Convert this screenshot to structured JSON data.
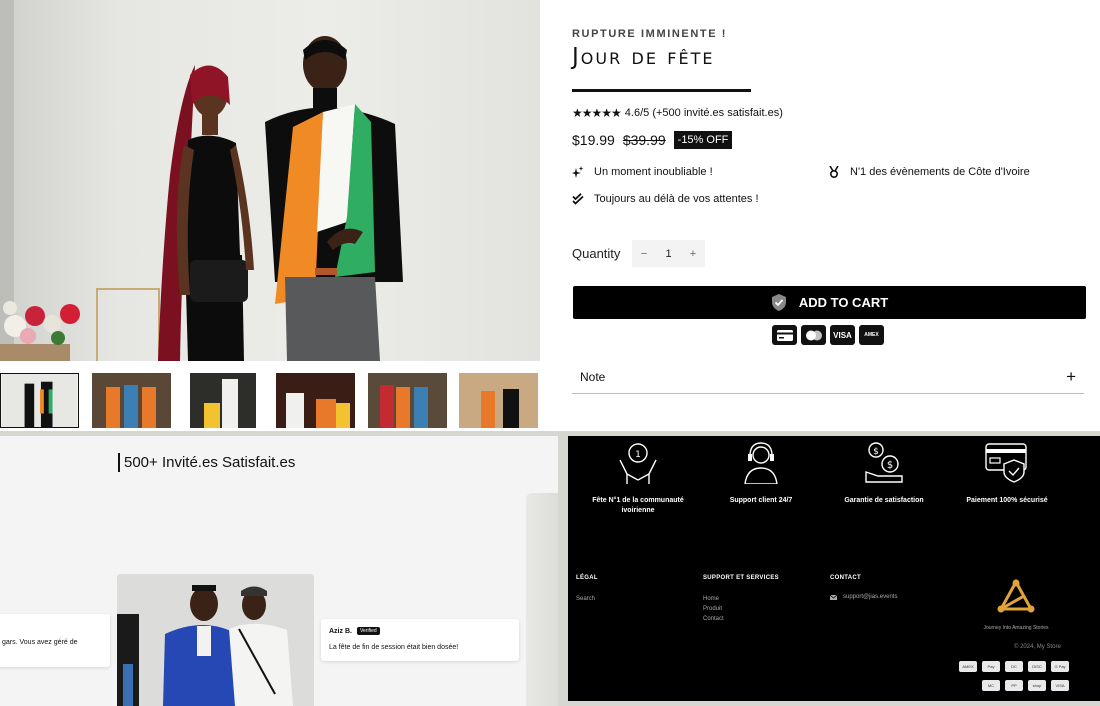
{
  "product": {
    "eyebrow": "RUPTURE IMMINENTE !",
    "title": "Jour de fête",
    "rating_stars": "★★★★★",
    "rating_text": "4.6/5 (+500 invité.es satisfait.es)",
    "price_current": "$19.99",
    "price_original": "$39.99",
    "discount_badge": "-15% OFF",
    "perks": [
      {
        "icon": "sparkle-icon",
        "text": "Un moment inoubliable !"
      },
      {
        "icon": "medal-icon",
        "text": "N'1 des évènements de Côte d'Ivoire"
      },
      {
        "icon": "double-check-icon",
        "text": "Toujours au délà de vos attentes !"
      }
    ],
    "quantity_label": "Quantity",
    "quantity_minus": "−",
    "quantity_value": "1",
    "quantity_plus": "+",
    "add_to_cart": "ADD TO CART",
    "payment_icons": [
      "card-icon",
      "mastercard-icon",
      "VISA",
      "AMEX"
    ],
    "note_label": "Note",
    "note_toggle": "+"
  },
  "testimonials": {
    "heading": "500+ Invité.es Satisfait.es",
    "left_card_snippet": "gars. Vous avez géré de",
    "right_card": {
      "name": "Aziz B.",
      "badge": "Verified",
      "text": "La fête de fin de session était bien dosée!"
    }
  },
  "footer": {
    "features": [
      {
        "icon": "trophy-hands-icon",
        "label": "Fête N°1 de la communauté ivoirienne"
      },
      {
        "icon": "headset-support-icon",
        "label": "Support client 24/7"
      },
      {
        "icon": "money-guarantee-icon",
        "label": "Garantie de satisfaction"
      },
      {
        "icon": "secure-card-icon",
        "label": "Paiement 100% sécurisé"
      }
    ],
    "legal_title": "LÉGAL",
    "legal_links": [
      "Search"
    ],
    "support_title": "SUPPORT ET SERVICES",
    "support_links": [
      "Home",
      "Produit",
      "Contact"
    ],
    "contact_title": "CONTACT",
    "contact_email": "support@jias.events",
    "brand_tagline": "Journey Into Amazing Stories",
    "copyright": "© 2024, My Store",
    "payment_row1": [
      "AMEX",
      "Pay",
      "DC",
      "DISC",
      "G Pay"
    ],
    "payment_row2": [
      "MC",
      "PP",
      "shop",
      "VISA"
    ]
  },
  "colors": {
    "accent": "#000000",
    "brand_gold": "#e0a43a",
    "flag_orange": "#f08a24",
    "flag_green": "#2fae63"
  }
}
